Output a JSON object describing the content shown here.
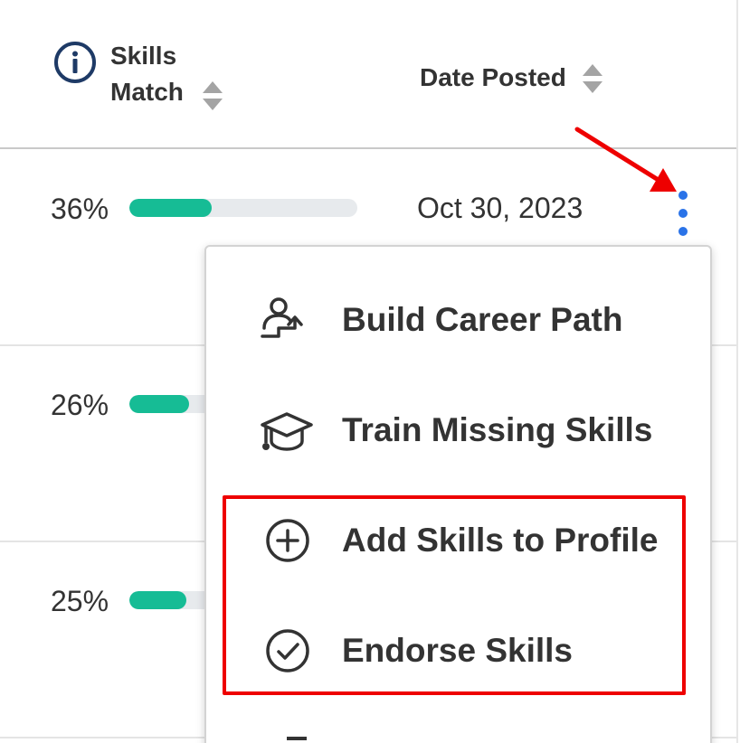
{
  "header": {
    "skills_match_label_line1": "Skills",
    "skills_match_label_line2": "Match",
    "date_posted_label": "Date Posted"
  },
  "rows": [
    {
      "skills_match_pct": "36%",
      "skills_match_value": 0.36,
      "date_posted": "Oct 30, 2023"
    },
    {
      "skills_match_pct": "26%",
      "skills_match_value": 0.26
    },
    {
      "skills_match_pct": "25%",
      "skills_match_value": 0.25
    }
  ],
  "row_menu": {
    "items": [
      {
        "label": "Build Career Path",
        "icon": "career-path-icon"
      },
      {
        "label": "Train Missing Skills",
        "icon": "graduation-cap-icon"
      },
      {
        "label": "Add Skills to Profile",
        "icon": "plus-circle-icon"
      },
      {
        "label": "Endorse Skills",
        "icon": "check-circle-icon"
      }
    ]
  },
  "colors": {
    "progress_fill": "#16bc95",
    "progress_track": "#e7eaed",
    "kebab": "#2a73e8",
    "annotation_red": "#ee0000",
    "info_icon": "#1e3a66"
  }
}
